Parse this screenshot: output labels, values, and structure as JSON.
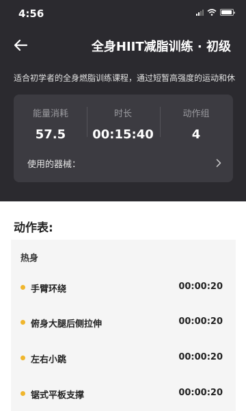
{
  "status_bar": {
    "time": "4:56"
  },
  "header": {
    "title": "全身HIIT减脂训练 · 初级",
    "description": "适合初学者的全身燃脂训练课程，通过短暂高强度的运动和休"
  },
  "stats": [
    {
      "label": "能量消耗",
      "value": "57.5"
    },
    {
      "label": "时长",
      "value": "00:15:40"
    },
    {
      "label": "动作组",
      "value": "4"
    }
  ],
  "equipment": {
    "label": "使用的器械："
  },
  "actions": {
    "section_title": "动作表:",
    "group_label": "热身",
    "items": [
      {
        "name": "手臂环绕",
        "duration": "00:00:20"
      },
      {
        "name": "俯身大腿后侧拉伸",
        "duration": "00:00:20"
      },
      {
        "name": "左右小跳",
        "duration": "00:00:20"
      },
      {
        "name": "锯式平板支撑",
        "duration": "00:00:20"
      }
    ]
  },
  "colors": {
    "header_bg": "#2b2a2f",
    "card_bg": "#3c3b41",
    "accent_dot": "#f0b62d",
    "list_bg": "#f5f5f5"
  }
}
